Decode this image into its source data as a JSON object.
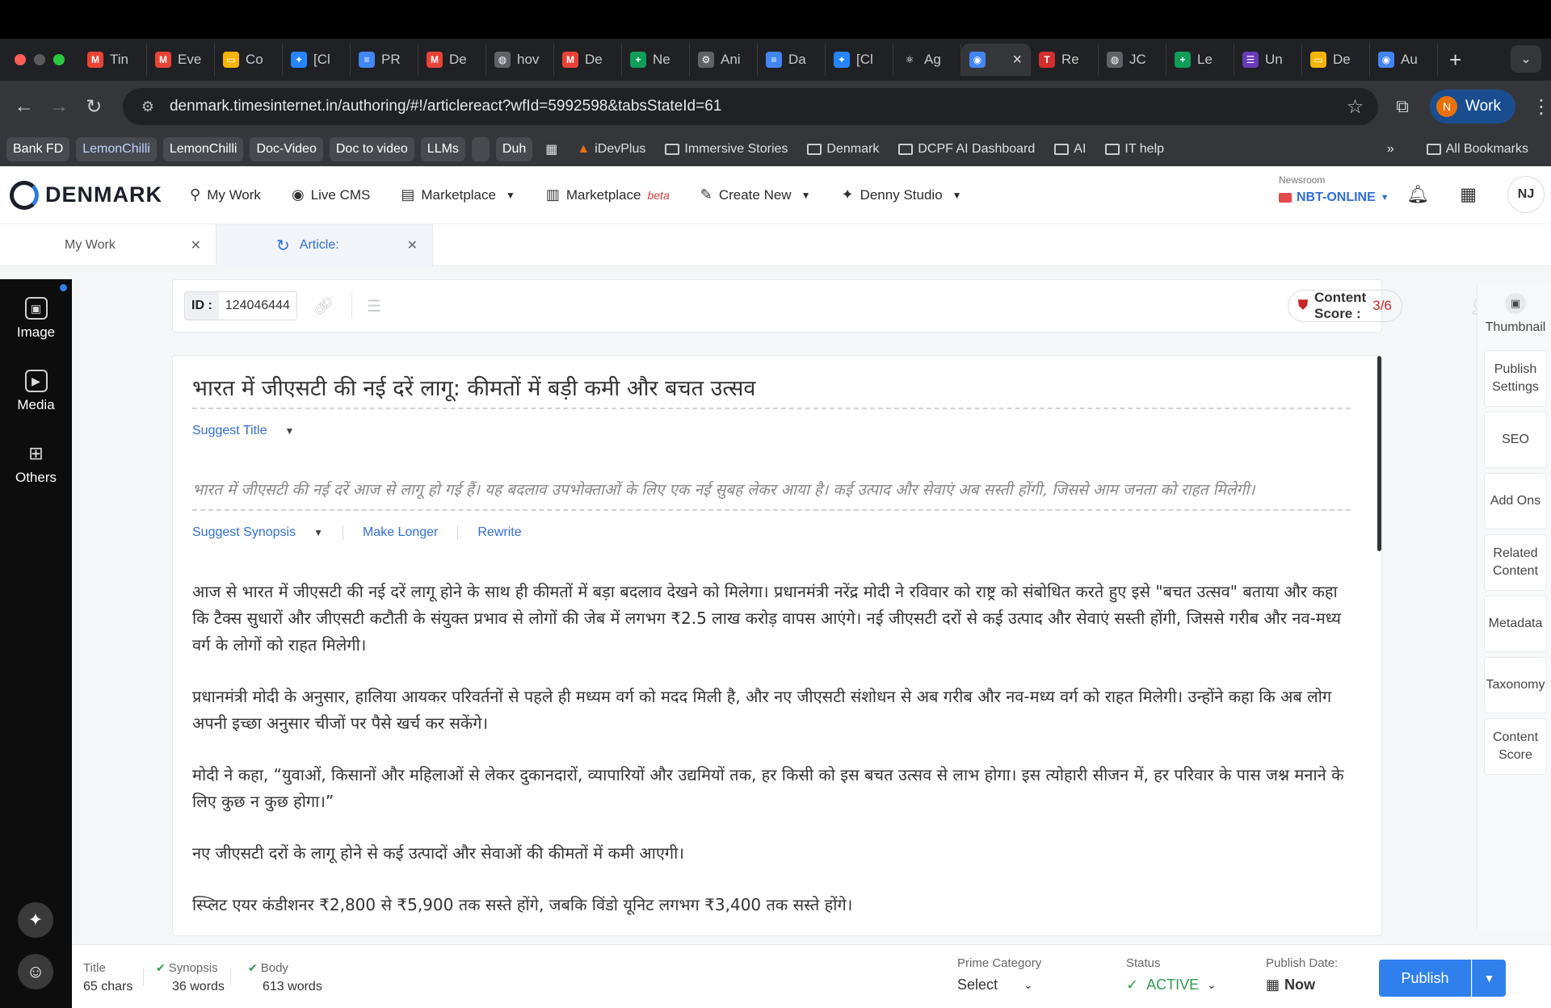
{
  "browser": {
    "tabs": [
      {
        "label": "Tin",
        "icon": "gmail-icon",
        "color": "#ea4335",
        "glyph": "M"
      },
      {
        "label": "Eve",
        "icon": "gmail-icon",
        "color": "#ea4335",
        "glyph": "M"
      },
      {
        "label": "Co",
        "icon": "slides-icon",
        "color": "#f4b400",
        "glyph": "▭"
      },
      {
        "label": "[Cl",
        "icon": "jira-icon",
        "color": "#2684ff",
        "glyph": "✦"
      },
      {
        "label": "PR",
        "icon": "docs-icon",
        "color": "#4285f4",
        "glyph": "≡"
      },
      {
        "label": "De",
        "icon": "gmail-icon",
        "color": "#ea4335",
        "glyph": "M"
      },
      {
        "label": "hov",
        "icon": "globe-icon",
        "color": "#5f6368",
        "glyph": "◍"
      },
      {
        "label": "De",
        "icon": "gmail-icon",
        "color": "#ea4335",
        "glyph": "M"
      },
      {
        "label": "Ne",
        "icon": "sheets-icon",
        "color": "#0f9d58",
        "glyph": "+"
      },
      {
        "label": "Ani",
        "icon": "robot-icon",
        "color": "#5f6368",
        "glyph": "⚙"
      },
      {
        "label": "Da",
        "icon": "docs-icon",
        "color": "#4285f4",
        "glyph": "≡"
      },
      {
        "label": "[Cl",
        "icon": "jira-icon",
        "color": "#2684ff",
        "glyph": "✦"
      },
      {
        "label": "Ag",
        "icon": "react-icon",
        "color": "#202124",
        "glyph": "⚛"
      },
      {
        "label": "",
        "icon": "chrome-icon",
        "color": "#4285f4",
        "glyph": "◉",
        "active": true
      },
      {
        "label": "Re",
        "icon": "toi-icon",
        "color": "#d32f2f",
        "glyph": "T"
      },
      {
        "label": "JC",
        "icon": "globe-icon",
        "color": "#5f6368",
        "glyph": "◍"
      },
      {
        "label": "Le",
        "icon": "sheets-icon",
        "color": "#0f9d58",
        "glyph": "+"
      },
      {
        "label": "Un",
        "icon": "forms-icon",
        "color": "#673ab7",
        "glyph": "☰"
      },
      {
        "label": "De",
        "icon": "slides-icon",
        "color": "#f4b400",
        "glyph": "▭"
      },
      {
        "label": "Au",
        "icon": "chrome-icon",
        "color": "#4285f4",
        "glyph": "◉"
      }
    ],
    "url": "denmark.timesinternet.in/authoring/#!/articlereact?wfId=5992598&tabsStateId=61",
    "profile_initial": "N",
    "profile_label": "Work",
    "bookmarks": [
      "Bank FD",
      "LemonChilli",
      "LemonChilli",
      "Doc-Video",
      "Doc to video",
      "LLMs",
      "",
      "Duh"
    ],
    "bookmark_items": [
      "iDevPlus",
      "Immersive Stories",
      "Denmark",
      "DCPF AI Dashboard",
      "AI",
      "IT help"
    ],
    "all_bookmarks": "All Bookmarks",
    "more_bookmarks": "»"
  },
  "app": {
    "brand": "DENMARK",
    "nav": {
      "my_work": "My Work",
      "live_cms": "Live CMS",
      "marketplace": "Marketplace",
      "marketplace_beta": "Marketplace",
      "beta_tag": "beta",
      "create_new": "Create New",
      "denny_studio": "Denny Studio"
    },
    "newsroom_label": "Newsroom",
    "newsroom_value": "NBT-ONLINE",
    "user_initials": "NJ"
  },
  "doc_tabs": {
    "my_work": "My Work",
    "article": "Article:"
  },
  "left_rail": {
    "image": "Image",
    "media": "Media",
    "others": "Others"
  },
  "toolbar": {
    "id_label": "ID :",
    "id_value": "124046444",
    "content_score_label": "Content Score :",
    "content_score_value": "3/6"
  },
  "article": {
    "title": "भारत में जीएसटी की नई दरें लागू: कीमतों में बड़ी कमी और बचत उत्सव",
    "suggest_title": "Suggest Title",
    "synopsis": "भारत में जीएसटी की नई दरें आज से लागू हो गई हैं। यह बदलाव उपभोक्ताओं के लिए एक नई सुबह लेकर आया है। कई उत्पाद और सेवाएं अब सस्ती होंगी, जिससे आम जनता को राहत मिलेगी।",
    "suggest_synopsis": "Suggest Synopsis",
    "make_longer": "Make Longer",
    "rewrite": "Rewrite",
    "paragraphs": [
      "आज से भारत में जीएसटी की नई दरें लागू होने के साथ ही कीमतों में बड़ा बदलाव देखने को मिलेगा। प्रधानमंत्री नरेंद्र मोदी ने रविवार को राष्ट्र को संबोधित करते हुए इसे \"बचत उत्सव\" बताया और कहा कि टैक्स सुधारों और जीएसटी कटौती के संयुक्त प्रभाव से लोगों की जेब में लगभग ₹2.5 लाख करोड़ वापस आएंगे। नई जीएसटी दरों से कई उत्पाद और सेवाएं सस्ती होंगी, जिससे गरीब और नव-मध्य वर्ग के लोगों को राहत मिलेगी।",
      "प्रधानमंत्री मोदी के अनुसार, हालिया आयकर परिवर्तनों से पहले ही मध्यम वर्ग को मदद मिली है, और नए जीएसटी संशोधन से अब गरीब और नव-मध्य वर्ग को राहत मिलेगी। उन्होंने कहा कि अब लोग अपनी इच्छा अनुसार चीजों पर पैसे खर्च कर सकेंगे।",
      "मोदी ने कहा, “युवाओं, किसानों और महिलाओं से लेकर दुकानदारों, व्यापारियों और उद्यमियों तक, हर किसी को इस बचत उत्सव से लाभ होगा। इस त्योहारी सीजन में, हर परिवार के पास जश्न मनाने के लिए कुछ न कुछ होगा।”",
      "नए जीएसटी दरों के लागू होने से कई उत्पादों और सेवाओं की कीमतों में कमी आएगी।",
      "स्प्लिट एयर कंडीशनर ₹2,800 से ₹5,900 तक सस्ते होंगे, जबकि विंडो यूनिट लगभग ₹3,400 तक सस्ते होंगे।"
    ]
  },
  "right_panel": [
    "Thumbnail",
    "Publish Settings",
    "SEO",
    "Add Ons",
    "Related Content",
    "Metadata",
    "Taxonomy",
    "Content Score"
  ],
  "footer": {
    "title_label": "Title",
    "title_value": "65 chars",
    "synopsis_label": "Synopsis",
    "synopsis_value": "36 words",
    "body_label": "Body",
    "body_value": "613 words",
    "prime_category_label": "Prime Category",
    "prime_category_value": "Select",
    "status_label": "Status",
    "status_value": "ACTIVE",
    "publish_date_label": "Publish Date:",
    "publish_date_value": "Now",
    "publish_button": "Publish"
  },
  "colors": {
    "accent": "#2f80ed",
    "link": "#2f6fd6",
    "danger": "#c62828",
    "success": "#2e9d4f"
  }
}
